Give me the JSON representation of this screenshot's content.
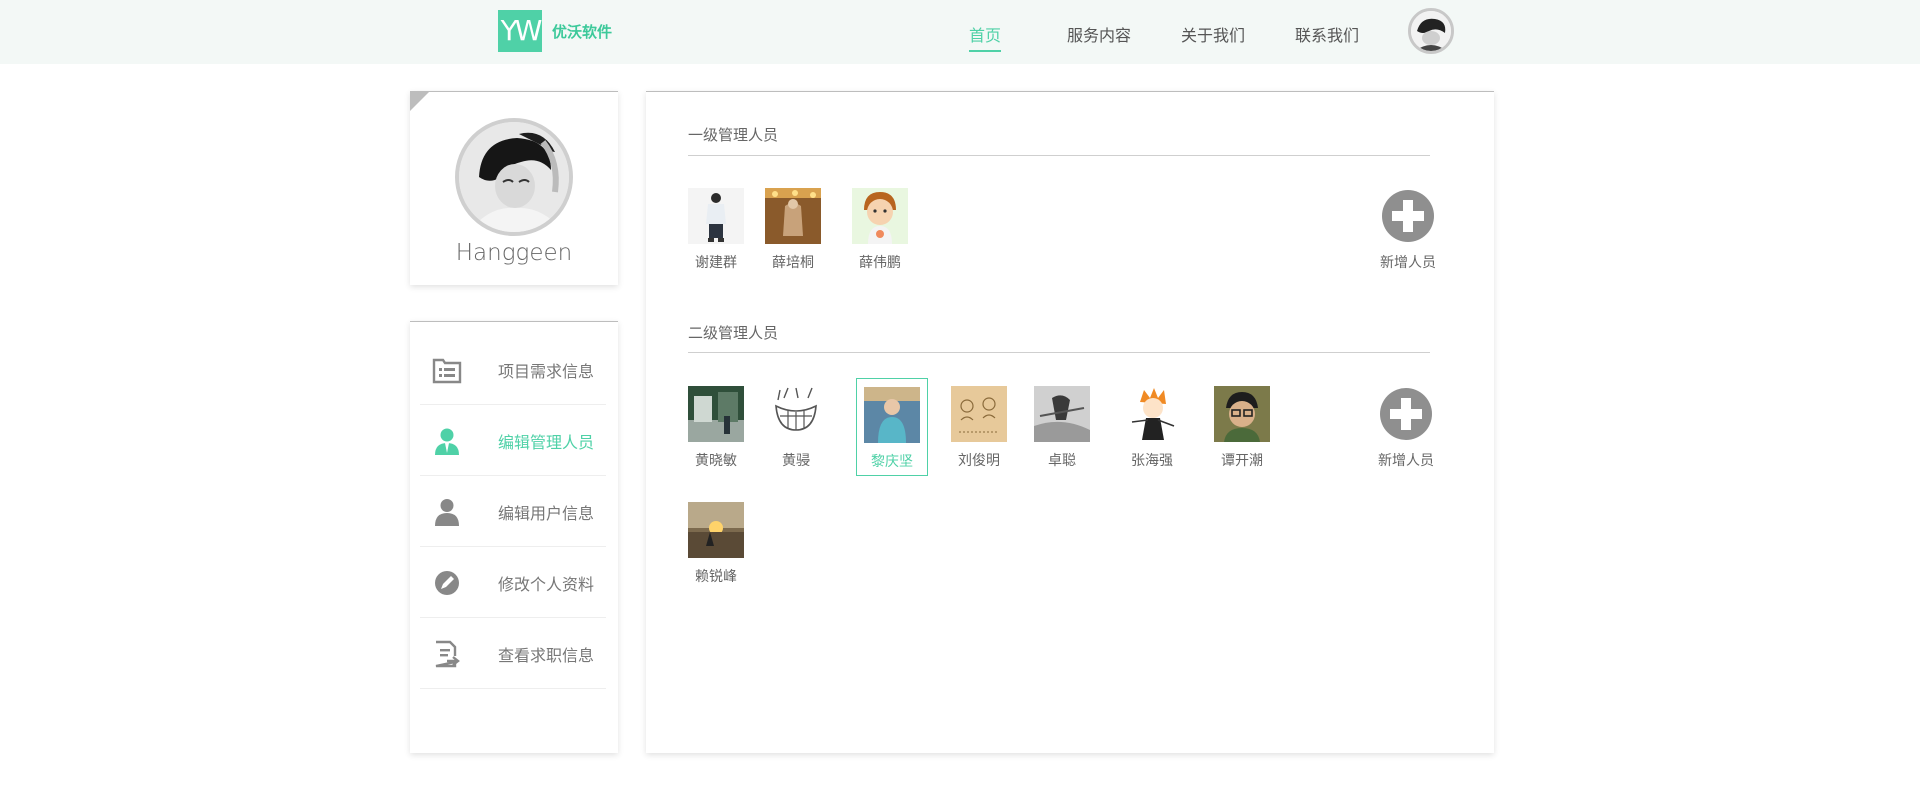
{
  "brand": {
    "logo_mark": "YW",
    "name": "优沃软件",
    "accent": "#4fd1a7"
  },
  "nav": {
    "items": [
      {
        "label": "首页",
        "active": true
      },
      {
        "label": "服务内容",
        "active": false
      },
      {
        "label": "关于我们",
        "active": false
      },
      {
        "label": "联系我们",
        "active": false
      }
    ]
  },
  "profile": {
    "name": "Hanggeen"
  },
  "sidebar": {
    "items": [
      {
        "label": "项目需求信息",
        "icon": "project-list-icon",
        "active": false
      },
      {
        "label": "编辑管理人员",
        "icon": "manager-icon",
        "active": true
      },
      {
        "label": "编辑用户信息",
        "icon": "user-icon",
        "active": false
      },
      {
        "label": "修改个人资料",
        "icon": "edit-profile-icon",
        "active": false
      },
      {
        "label": "查看求职信息",
        "icon": "job-document-icon",
        "active": false
      }
    ]
  },
  "level1": {
    "title": "一级管理人员",
    "members": [
      "谢建群",
      "薛培桐",
      "薛伟鹏"
    ],
    "add_label": "新增人员"
  },
  "level2": {
    "title": "二级管理人员",
    "members": [
      "黄晓敏",
      "黄骎",
      "黎庆坚",
      "刘俊明",
      "卓聪",
      "张海强",
      "谭开潮",
      "赖锐峰"
    ],
    "selected": "黎庆坚",
    "add_label": "新增人员"
  }
}
